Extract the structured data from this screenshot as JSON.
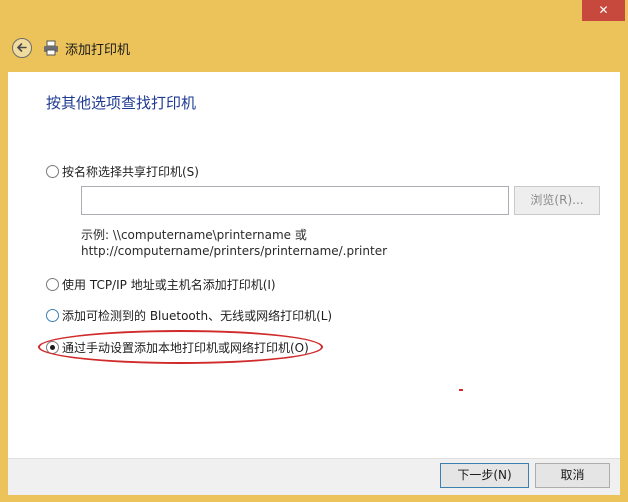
{
  "window": {
    "title": "添加打印机",
    "close_symbol": "✕",
    "back_icon": "back-arrow-icon",
    "printer_icon": "printer-icon"
  },
  "main": {
    "heading": "按其他选项查找打印机",
    "options": [
      {
        "label": "按名称选择共享打印机(S)",
        "selected": false
      },
      {
        "label": "使用 TCP/IP 地址或主机名添加打印机(I)",
        "selected": false
      },
      {
        "label": "添加可检测到的 Bluetooth、无线或网络打印机(L)",
        "selected": false
      },
      {
        "label": "通过手动设置添加本地打印机或网络打印机(O)",
        "selected": true
      }
    ],
    "shared_printer_input": {
      "value": "",
      "placeholder": ""
    },
    "browse_label": "浏览(R)...",
    "example_line1": "示例: \\\\computername\\printername 或",
    "example_line2": "http://computername/printers/printername/.printer"
  },
  "footer": {
    "next_label": "下一步(N)",
    "cancel_label": "取消"
  },
  "colors": {
    "frame": "#ebc35a",
    "heading": "#1f3a93",
    "annotation": "#d02a2a",
    "close": "#c7483c"
  }
}
